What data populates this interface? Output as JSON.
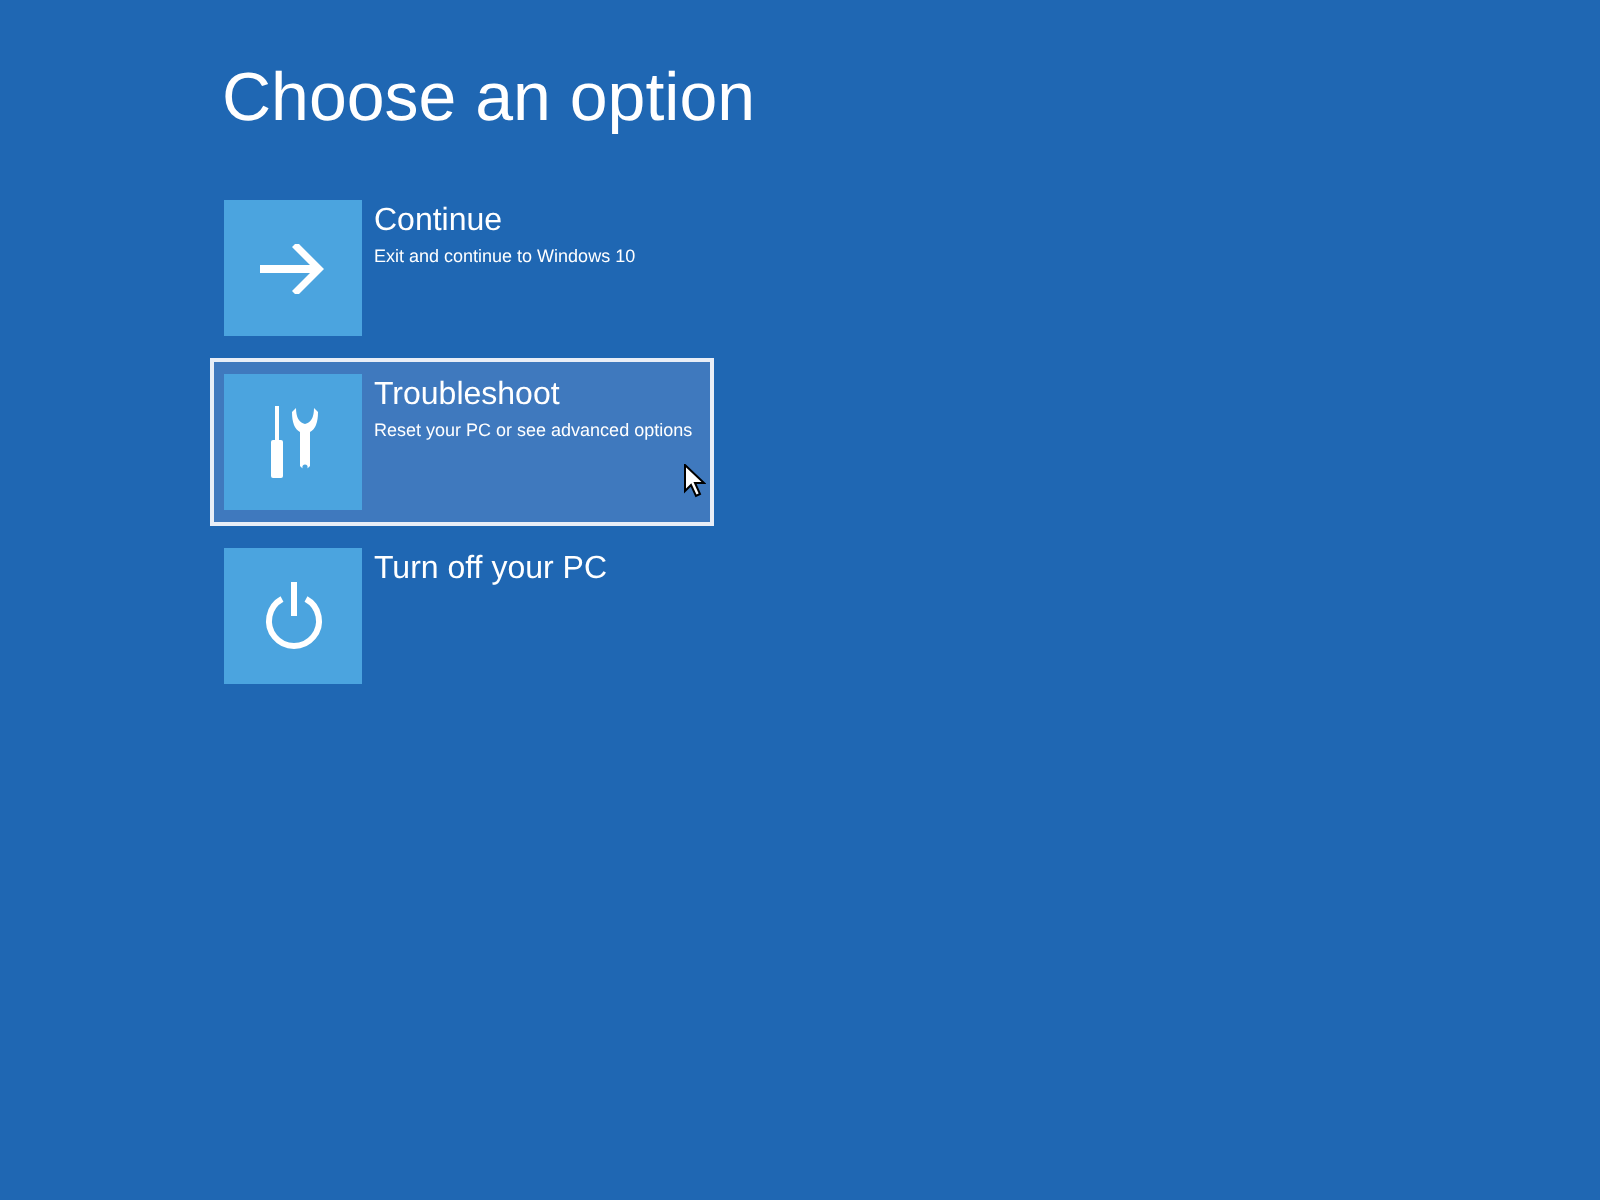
{
  "title": "Choose an option",
  "options": [
    {
      "kind": "arrow",
      "title": "Continue",
      "description": "Exit and continue to Windows 10",
      "selected": false
    },
    {
      "kind": "tools",
      "title": "Troubleshoot",
      "description": "Reset your PC or see advanced options",
      "selected": true
    },
    {
      "kind": "power",
      "title": "Turn off your PC",
      "selected": false
    }
  ]
}
